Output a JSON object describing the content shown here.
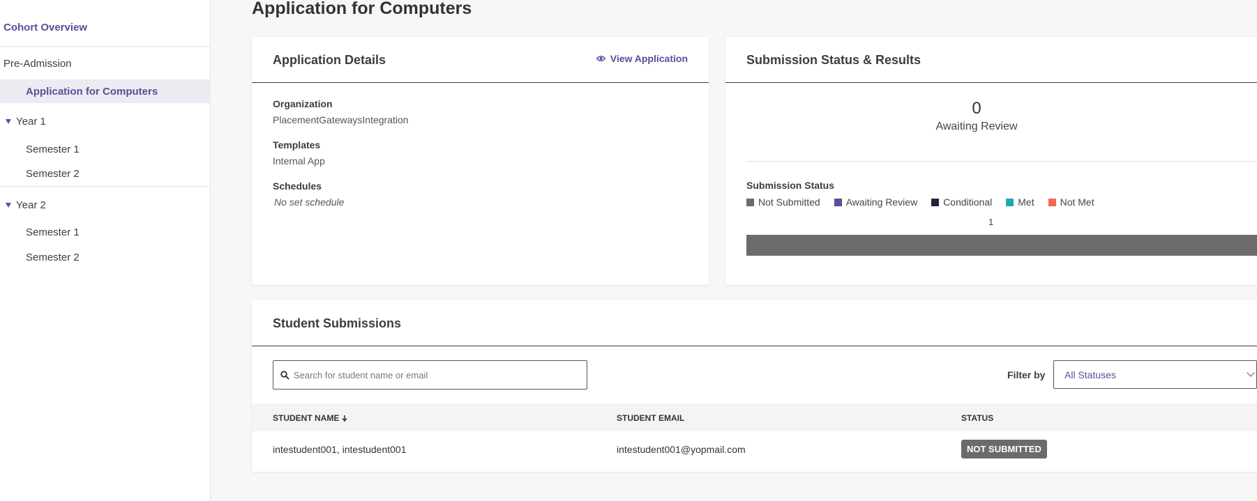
{
  "sidebar": {
    "cohort_overview": "Cohort Overview",
    "pre_admission": "Pre-Admission",
    "active_item": "Application for Computers",
    "years": [
      {
        "label": "Year 1",
        "semesters": [
          "Semester 1",
          "Semester 2"
        ]
      },
      {
        "label": "Year 2",
        "semesters": [
          "Semester 1",
          "Semester 2"
        ]
      }
    ]
  },
  "page": {
    "title": "Application for Computers"
  },
  "details": {
    "title": "Application Details",
    "view_link": "View Application",
    "view_icon": "eye-icon",
    "organization_label": "Organization",
    "organization_value": "PlacementGatewaysIntegration",
    "templates_label": "Templates",
    "templates_value": "Internal App",
    "schedules_label": "Schedules",
    "schedules_value": "No set schedule"
  },
  "status_card": {
    "title": "Submission Status & Results",
    "awaiting_count": "0",
    "awaiting_label": "Awaiting Review",
    "chart_label": "Submission Status"
  },
  "chart_data": {
    "type": "bar",
    "orientation": "horizontal-stacked",
    "title": "Submission Status",
    "series": [
      {
        "name": "Not Submitted",
        "color": "#6b6b6b",
        "value": 1
      },
      {
        "name": "Awaiting Review",
        "color": "#5a4e98",
        "value": 0
      },
      {
        "name": "Conditional",
        "color": "#2b1f3d",
        "value": 0
      },
      {
        "name": "Met",
        "color": "#1fa8a8",
        "value": 0
      },
      {
        "name": "Not Met",
        "color": "#f06a50",
        "value": 0
      }
    ],
    "legend_position": "top-left"
  },
  "submissions": {
    "title": "Student Submissions",
    "search_placeholder": "Search for student name or email",
    "filter_label": "Filter by",
    "filter_value": "All Statuses",
    "columns": {
      "name": "STUDENT NAME",
      "email": "STUDENT EMAIL",
      "status": "STATUS"
    },
    "rows": [
      {
        "name": "intestudent001, intestudent001",
        "email": "intestudent001@yopmail.com",
        "status": "NOT SUBMITTED"
      }
    ]
  },
  "colors": {
    "accent": "#5a4e98",
    "not_submitted": "#6b6b6b"
  }
}
